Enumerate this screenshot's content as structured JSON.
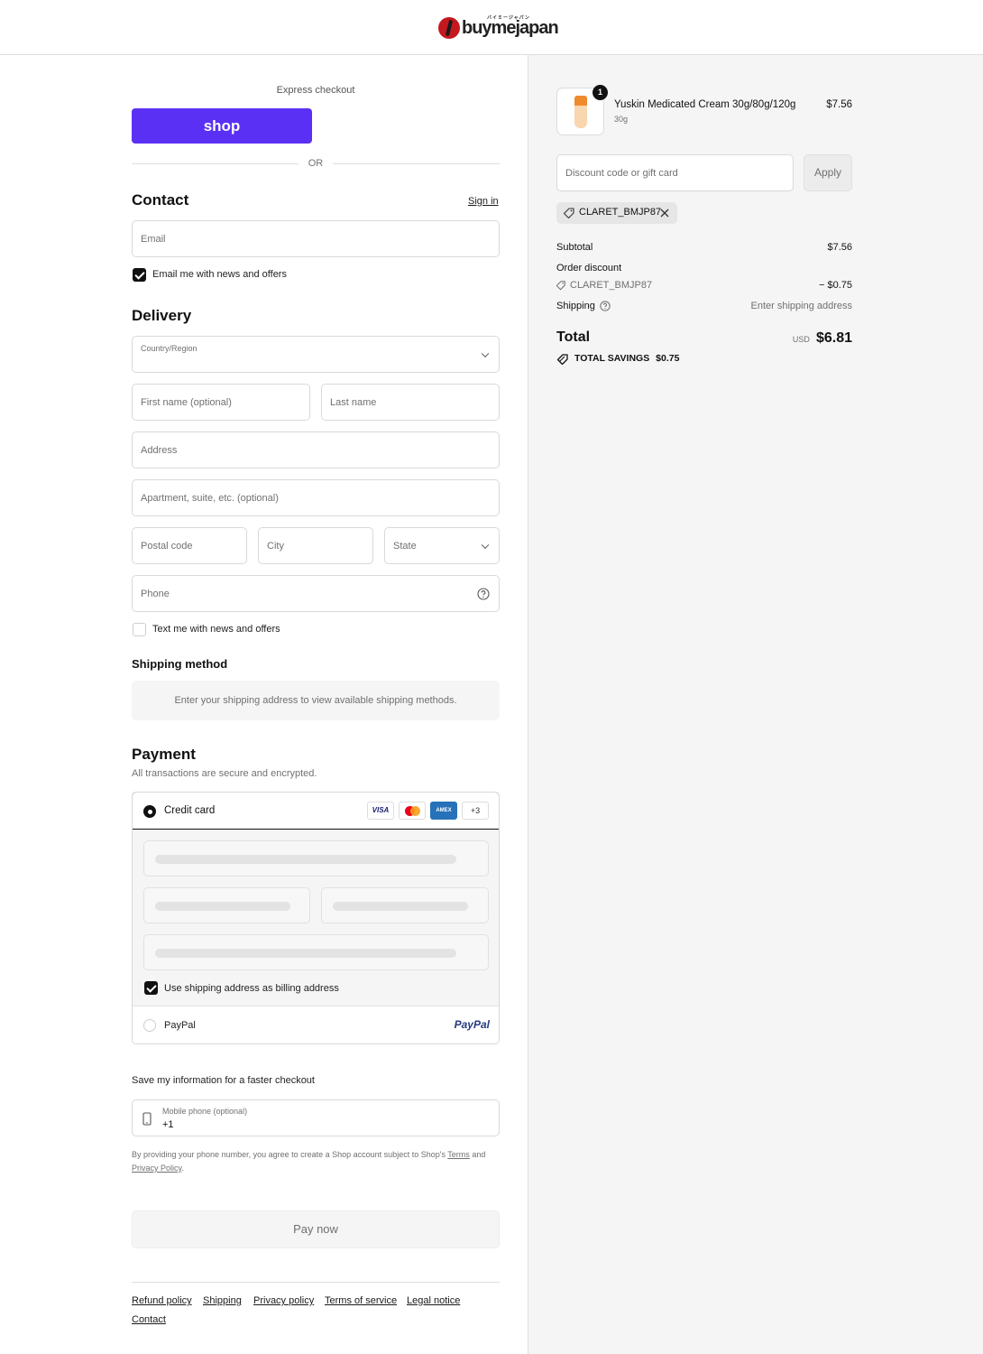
{
  "brand": {
    "name": "buymejapan",
    "tagline": "バイミージャパン"
  },
  "express": {
    "label": "Express checkout",
    "shop_button": "shop",
    "or": "OR"
  },
  "contact": {
    "title": "Contact",
    "sign_in": "Sign in",
    "email_placeholder": "Email",
    "news_checkbox": "Email me with news and offers",
    "news_checked": true
  },
  "delivery": {
    "title": "Delivery",
    "country_label": "Country/Region",
    "first_name": "First name (optional)",
    "last_name": "Last name",
    "address": "Address",
    "apartment": "Apartment, suite, etc. (optional)",
    "postal": "Postal code",
    "city": "City",
    "state": "State",
    "phone": "Phone",
    "text_checkbox": "Text me with news and offers",
    "text_checked": false
  },
  "shipping_method": {
    "title": "Shipping method",
    "notice": "Enter your shipping address to view available shipping methods."
  },
  "payment": {
    "title": "Payment",
    "subtitle": "All transactions are secure and encrypted.",
    "credit_card": "Credit card",
    "cards": [
      "VISA",
      "AMEX",
      "+3"
    ],
    "billing_checkbox": "Use shipping address as billing address",
    "billing_checked": true,
    "paypal": "PayPal",
    "paypal_logo": "PayPal"
  },
  "save_info": {
    "title": "Save my information for a faster checkout",
    "mobile_label": "Mobile phone (optional)",
    "mobile_value": "+1",
    "disclaimer_1": "By providing your phone number, you agree to create a Shop account subject to Shop's",
    "terms": "Terms",
    "and": "and",
    "privacy": "Privacy Policy",
    "period": "."
  },
  "pay_now": "Pay now",
  "footer_links": [
    "Refund policy",
    "Shipping",
    "Privacy policy",
    "Terms of service",
    "Legal notice",
    "Contact"
  ],
  "order": {
    "item": {
      "name": "Yuskin Medicated Cream 30g/80g/120g",
      "variant": "30g",
      "price": "$7.56",
      "quantity": "1"
    },
    "discount_placeholder": "Discount code or gift card",
    "apply": "Apply",
    "applied_code": "CLARET_BMJP87",
    "subtotal_label": "Subtotal",
    "subtotal_value": "$7.56",
    "order_discount_label": "Order discount",
    "discount_code": "CLARET_BMJP87",
    "discount_value": "− $0.75",
    "shipping_label": "Shipping",
    "shipping_value": "Enter shipping address",
    "total_label": "Total",
    "currency": "USD",
    "total_value": "$6.81",
    "savings_label": "TOTAL SAVINGS",
    "savings_value": "$0.75"
  },
  "colors": {
    "shop_purple": "#5a31f4",
    "paypal_blue": "#253b80",
    "paypal_light": "#179bd7"
  }
}
